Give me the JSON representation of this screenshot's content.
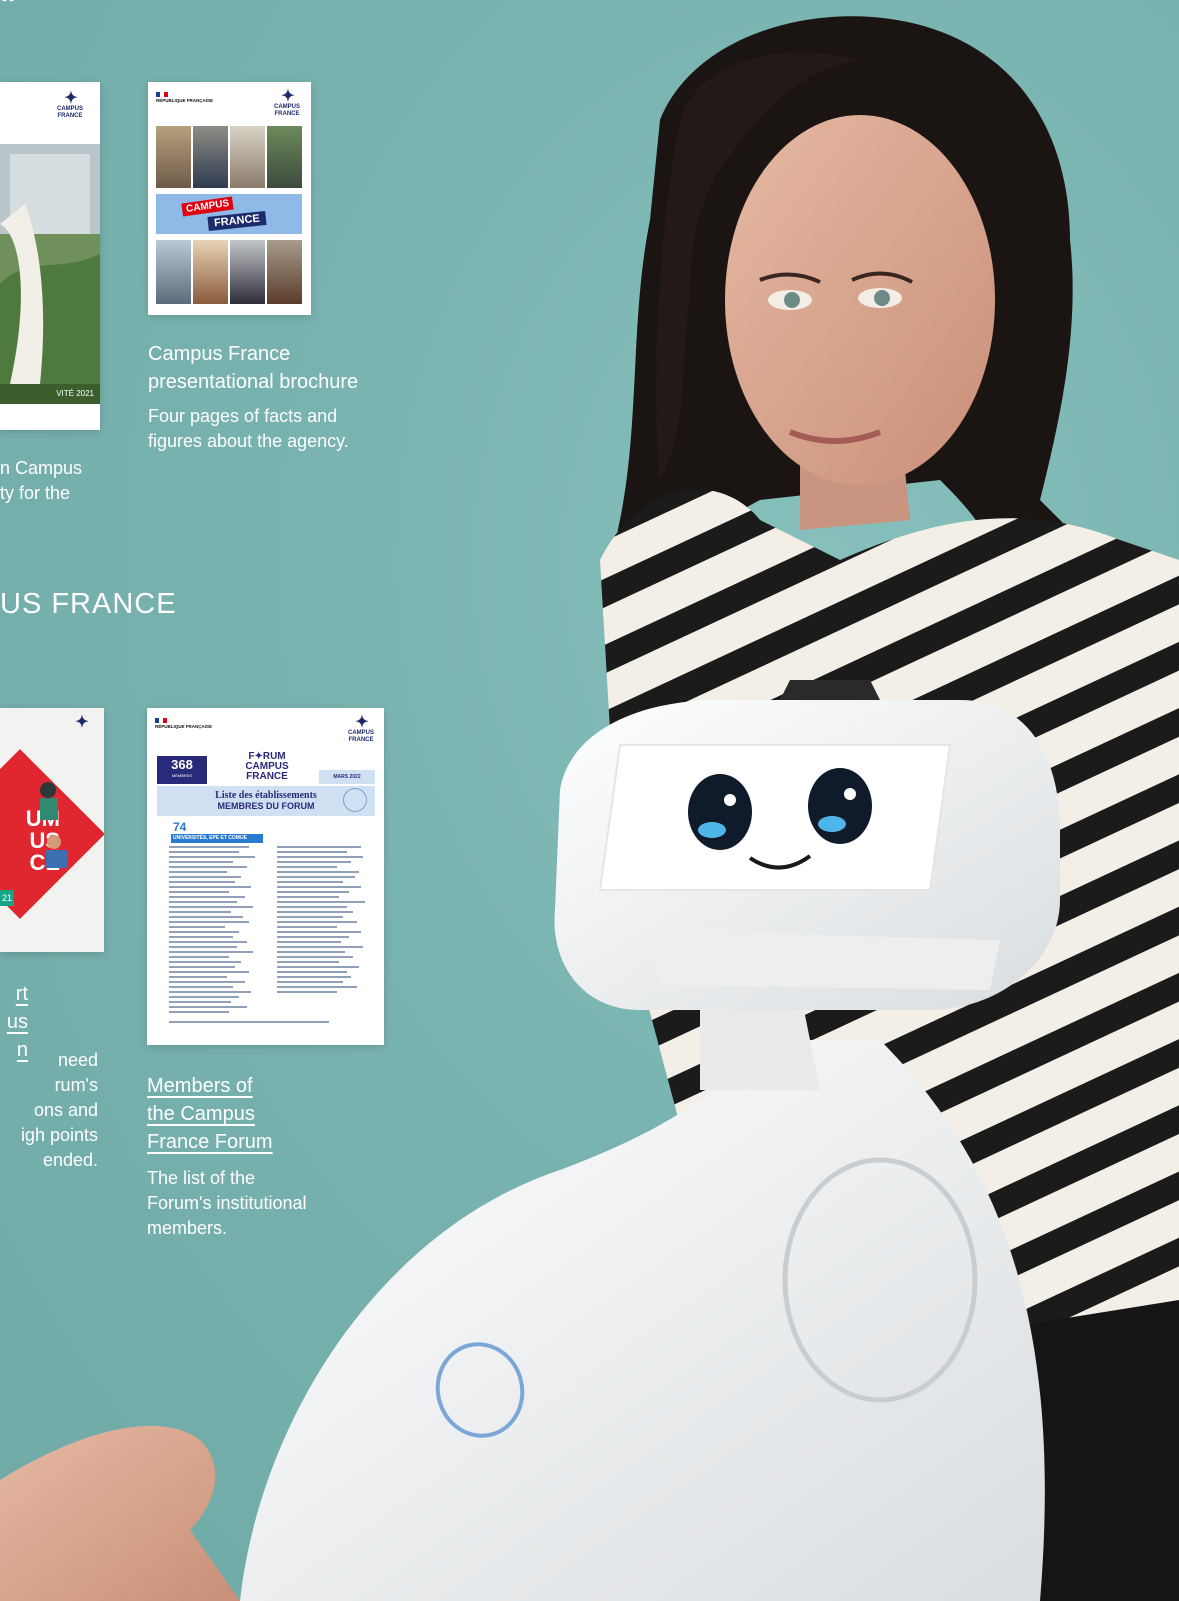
{
  "top_mark": "\"",
  "section": {
    "title": "US FRANCE"
  },
  "docs": {
    "report": {
      "logo": "CAMPUS FRANCE",
      "footer": "VITÉ 2021",
      "caption_tail": [
        "n Campus",
        "ty for the"
      ]
    },
    "brochure": {
      "republique": "RÉPUBLIQUE FRANÇAISE",
      "logo": "CAMPUS FRANCE",
      "band_line1": "CAMPUS",
      "band_line2": "FRANCE",
      "title_lines": [
        "Campus France",
        "presentational brochure"
      ],
      "body_lines": [
        "Four pages of facts and",
        "figures about the agency."
      ]
    },
    "forum_report": {
      "logo": "CAMPUS FRANCE",
      "poster_lines": [
        "UM",
        "US",
        "CE"
      ],
      "badge": "21",
      "title_lines": [
        "rt",
        "us",
        "n"
      ],
      "body_lines": [
        "need",
        "rum's",
        "ons and",
        "igh points",
        "ended."
      ]
    },
    "members": {
      "republique": "RÉPUBLIQUE FRANÇAISE",
      "logo": "CAMPUS FRANCE",
      "count": "368",
      "count_label": "MEMBRES",
      "forum_line1": "F✦RUM",
      "forum_line2": "CAMPUS",
      "forum_line3": "FRANCE",
      "date": "MARS 2022",
      "list_title_1": "Liste des établissements",
      "list_title_2": "MEMBRES DU FORUM",
      "sub_count": "74",
      "sub_label": "UNIVERSITÉS, EPE ET COMUE",
      "title_lines": [
        "Members of",
        "the Campus",
        "France Forum"
      ],
      "body_lines": [
        "The list of the",
        "Forum's institutional",
        "members."
      ]
    }
  },
  "colors": {
    "background": "#77b2ae",
    "navy": "#1c2b6b",
    "red": "#e1000f",
    "band_blue": "#8fb9e6",
    "forum_red": "#e0262e",
    "members_band": "#cfe0f2"
  }
}
